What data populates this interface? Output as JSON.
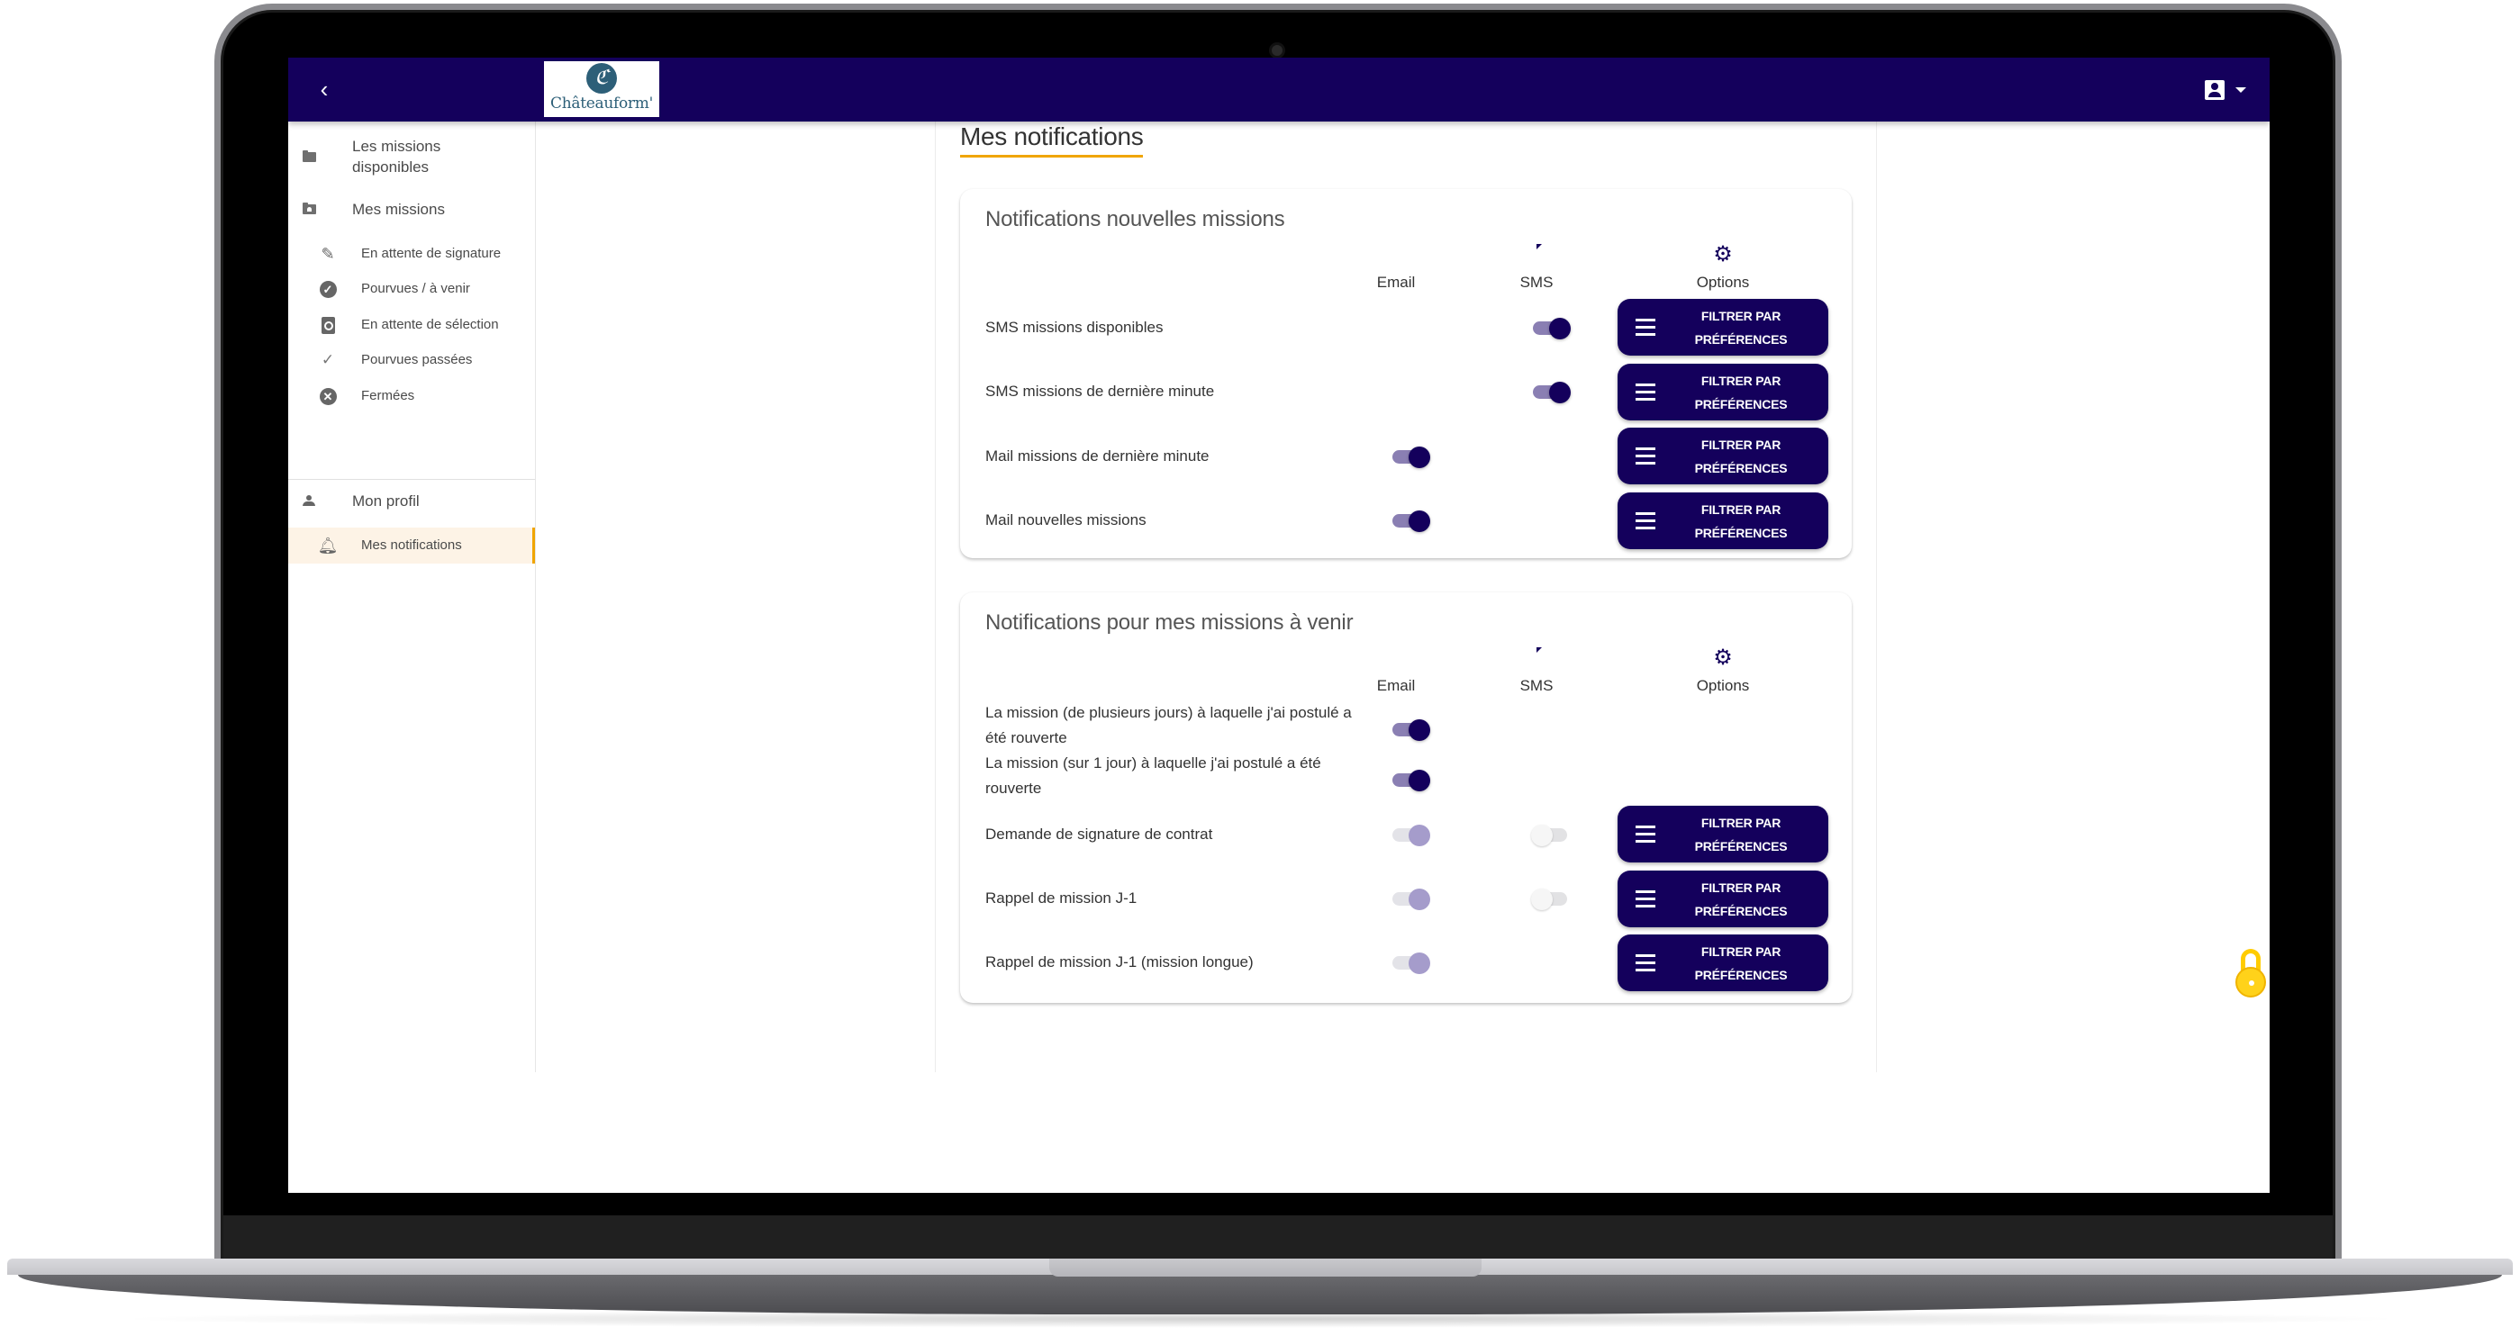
{
  "header": {
    "back_icon": "chevron-left-icon",
    "logo_mark": "ℭ",
    "logo_text": "Châteauform'",
    "user_icon": "account-box-icon",
    "menu_caret": "caret-down-icon"
  },
  "sidebar": {
    "items": [
      {
        "label": "Les missions disponibles",
        "icon": "folder-icon",
        "level": 1
      },
      {
        "label": "Mes missions",
        "icon": "folder-shared-icon",
        "level": 1
      },
      {
        "label": "En attente de signature",
        "icon": "pencil-icon",
        "level": 2
      },
      {
        "label": "Pourvues / à venir",
        "icon": "check-circle-icon",
        "level": 2
      },
      {
        "label": "En attente de sélection",
        "icon": "find-in-page-icon",
        "level": 2
      },
      {
        "label": "Pourvues passées",
        "icon": "check-icon",
        "level": 2
      },
      {
        "label": "Fermées",
        "icon": "cancel-icon",
        "level": 2
      },
      {
        "label": "Mon profil",
        "icon": "person-icon",
        "level": 1
      },
      {
        "label": "Mes notifications",
        "icon": "bell-icon",
        "level": 2,
        "active": true
      }
    ]
  },
  "main": {
    "title": "Mes notifications",
    "columns": {
      "email": "Email",
      "sms": "SMS",
      "options": "Options"
    },
    "filter_button_line1": "FILTRER PAR",
    "filter_button_line2": "PRÉFÉRENCES",
    "sections": [
      {
        "title": "Notifications nouvelles missions",
        "rows": [
          {
            "label": "SMS missions disponibles",
            "email": null,
            "sms": "on",
            "filter": true
          },
          {
            "label": "SMS missions de dernière minute",
            "email": null,
            "sms": "on",
            "filter": true
          },
          {
            "label": "Mail missions de dernière minute",
            "email": "on",
            "sms": null,
            "filter": true
          },
          {
            "label": "Mail nouvelles missions",
            "email": "on",
            "sms": null,
            "filter": true
          }
        ]
      },
      {
        "title": "Notifications pour mes missions à venir",
        "rows": [
          {
            "label": "La mission (de plusieurs jours) à laquelle j'ai postulé a été rouverte",
            "email": "on",
            "sms": null,
            "filter": false
          },
          {
            "label": "La mission (sur 1 jour) à laquelle j'ai postulé a été rouverte",
            "email": "on",
            "sms": null,
            "filter": false
          },
          {
            "label": "Demande de signature de contrat",
            "email": "on-disabled",
            "sms": "off-disabled",
            "filter": true
          },
          {
            "label": "Rappel de mission J-1",
            "email": "on-disabled",
            "sms": "off-disabled",
            "filter": true
          },
          {
            "label": "Rappel de mission J-1 (mission longue)",
            "email": "on-disabled",
            "sms": null,
            "filter": true
          }
        ]
      }
    ]
  },
  "colors": {
    "primary": "#14005c",
    "accent": "#f0a500",
    "active_bg": "#fdf3e6",
    "toggle_track_on": "#8a7fb3",
    "toggle_thumb_disabled_on": "#a59ccb"
  },
  "cookie_widget": {
    "icon": "lemon-lock-icon"
  }
}
